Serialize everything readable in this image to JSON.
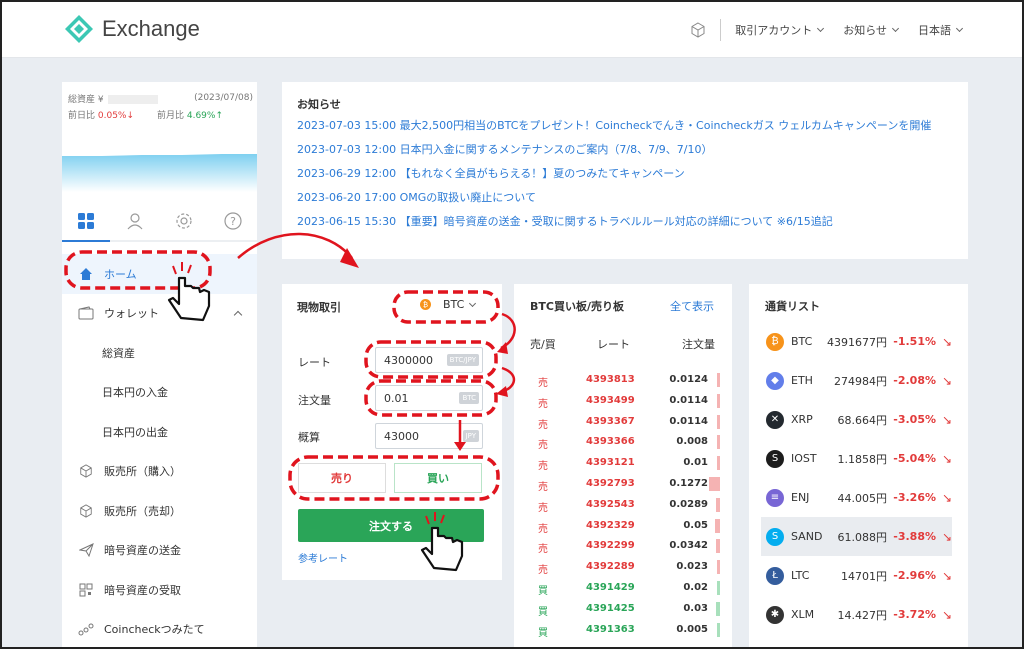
{
  "header": {
    "logo_text": "Exchange",
    "nav": [
      "取引アカウント",
      "お知らせ",
      "日本語"
    ]
  },
  "sidebar": {
    "asset_label": "総資産",
    "asset_currency": "¥",
    "asset_date": "(2023/07/08)",
    "daychange_label": "前日比",
    "daychange_value": "0.05%↓",
    "prevmonth_label": "前月比",
    "prevmonth_value": "4.69%↑",
    "tabs": [
      "dashboard",
      "user",
      "settings",
      "help"
    ],
    "items": [
      {
        "label": "ホーム",
        "icon": "home-icon"
      },
      {
        "label": "ウォレット",
        "icon": "wallet-icon"
      },
      {
        "label": "総資産",
        "icon": ""
      },
      {
        "label": "日本円の入金",
        "icon": ""
      },
      {
        "label": "日本円の出金",
        "icon": ""
      },
      {
        "label": "販売所（購入）",
        "icon": "cube-icon"
      },
      {
        "label": "販売所（売却）",
        "icon": "cube-icon"
      },
      {
        "label": "暗号資産の送金",
        "icon": "send-icon"
      },
      {
        "label": "暗号資産の受取",
        "icon": "qr-icon"
      },
      {
        "label": "Coincheckつみたて",
        "icon": "dots-icon"
      }
    ]
  },
  "news": {
    "title": "お知らせ",
    "items": [
      "2023-07-03 15:00 最大2,500円相当のBTCをプレゼント！Coincheckでんき・Coincheckガス ウェルカムキャンペーンを開催",
      "2023-07-03 12:00 日本円入金に関するメンテナンスのご案内（7/8、7/9、7/10）",
      "2023-06-29 12:00 【もれなく全員がもらえる！】夏のつみたてキャンペーン",
      "2023-06-20 17:00 OMGの取扱い廃止について",
      "2023-06-15 15:30 【重要】暗号資産の送金・受取に関するトラベルルール対応の詳細について ※6/15追記"
    ]
  },
  "trade": {
    "title": "現物取引",
    "coin": "BTC",
    "rate_label": "レート",
    "rate_value": "4300000",
    "rate_unit": "BTC/JPY",
    "amount_label": "注文量",
    "amount_value": "0.01",
    "amount_unit": "BTC",
    "estimate_label": "概算",
    "estimate_value": "43000",
    "estimate_unit": "JPY",
    "sell_label": "売り",
    "buy_label": "買い",
    "order_label": "注文する",
    "ref_label": "参考レート"
  },
  "orderbook": {
    "title": "BTC買い板/売り板",
    "show_all": "全て表示",
    "headers": [
      "売/買",
      "レート",
      "注文量"
    ],
    "rows": [
      {
        "side": "売",
        "rate": "4393813",
        "qty": "0.0124",
        "depth": 0.1
      },
      {
        "side": "売",
        "rate": "4393499",
        "qty": "0.0114",
        "depth": 0.1
      },
      {
        "side": "売",
        "rate": "4393367",
        "qty": "0.0114",
        "depth": 0.1
      },
      {
        "side": "売",
        "rate": "4393366",
        "qty": "0.008",
        "depth": 0
      },
      {
        "side": "売",
        "rate": "4393121",
        "qty": "0.01",
        "depth": 0.1
      },
      {
        "side": "売",
        "rate": "4392793",
        "qty": "0.1272",
        "depth": 0.8
      },
      {
        "side": "売",
        "rate": "4392543",
        "qty": "0.0289",
        "depth": 0.25
      },
      {
        "side": "売",
        "rate": "4392329",
        "qty": "0.05",
        "depth": 0.35
      },
      {
        "side": "売",
        "rate": "4392299",
        "qty": "0.0342",
        "depth": 0.3
      },
      {
        "side": "売",
        "rate": "4392289",
        "qty": "0.023",
        "depth": 0.2
      },
      {
        "side": "買",
        "rate": "4391429",
        "qty": "0.02",
        "depth": 0.2
      },
      {
        "side": "買",
        "rate": "4391425",
        "qty": "0.03",
        "depth": 0.25
      },
      {
        "side": "買",
        "rate": "4391363",
        "qty": "0.005",
        "depth": 0
      }
    ]
  },
  "coins": {
    "title": "通貨リスト",
    "rows": [
      {
        "sym": "BTC",
        "price": "4391677円",
        "chg": "-1.51%",
        "color": "#f7931a",
        "glyph": "₿"
      },
      {
        "sym": "ETH",
        "price": "274984円",
        "chg": "-2.08%",
        "color": "#627eea",
        "glyph": "◆"
      },
      {
        "sym": "XRP",
        "price": "68.664円",
        "chg": "-3.05%",
        "color": "#23292f",
        "glyph": "✕"
      },
      {
        "sym": "IOST",
        "price": "1.1858円",
        "chg": "-5.04%",
        "color": "#1c1c1c",
        "glyph": "S"
      },
      {
        "sym": "ENJ",
        "price": "44.005円",
        "chg": "-3.26%",
        "color": "#7866d5",
        "glyph": "≡"
      },
      {
        "sym": "SAND",
        "price": "61.088円",
        "chg": "-3.88%",
        "color": "#04adef",
        "glyph": "S"
      },
      {
        "sym": "LTC",
        "price": "14701円",
        "chg": "-2.96%",
        "color": "#345d9d",
        "glyph": "Ł"
      },
      {
        "sym": "XLM",
        "price": "14.427円",
        "chg": "-3.72%",
        "color": "#333333",
        "glyph": "✱"
      }
    ]
  }
}
